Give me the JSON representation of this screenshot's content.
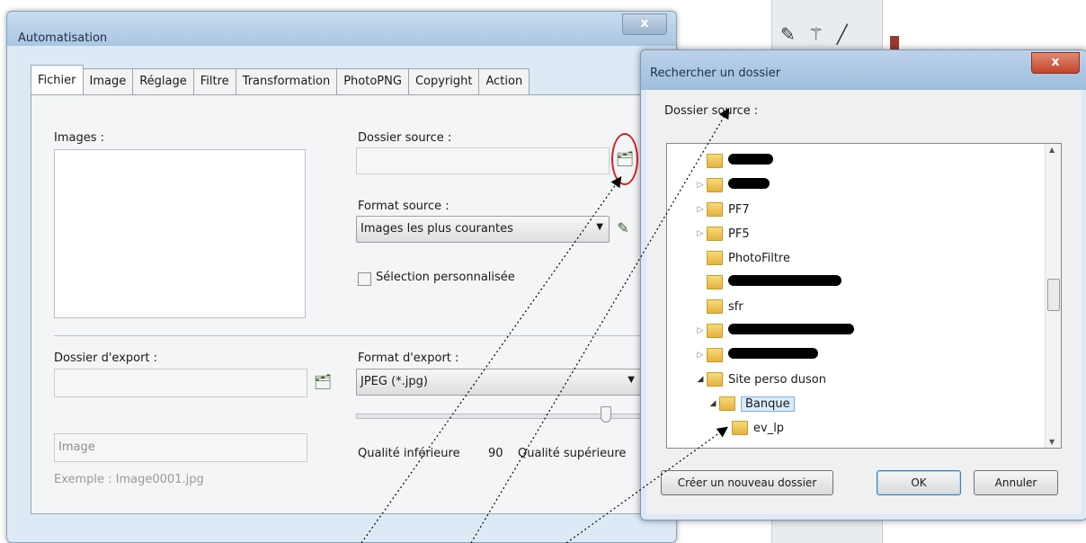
{
  "automatisation": {
    "title": "Automatisation",
    "close": "x",
    "tabs": [
      {
        "label": "Fichier",
        "active": true
      },
      {
        "label": "Image"
      },
      {
        "label": "Réglage"
      },
      {
        "label": "Filtre"
      },
      {
        "label": "Transformation"
      },
      {
        "label": "PhotoPNG"
      },
      {
        "label": "Copyright"
      },
      {
        "label": "Action"
      }
    ],
    "images_label": "Images :",
    "dossier_source_label": "Dossier source :",
    "format_source_label": "Format source :",
    "format_source_value": "Images les plus courantes",
    "selection_label": "Sélection personnalisée",
    "dossier_export_label": "Dossier d'export :",
    "format_export_label": "Format d'export :",
    "format_export_value": "JPEG (*.jpg)",
    "image_name_value": "Image",
    "example_text": "Exemple : Image0001.jpg",
    "quality_low": "Qualité inférieure",
    "quality_value": "90",
    "quality_high": "Qualité supérieure"
  },
  "folder_browser": {
    "title": "Rechercher un dossier",
    "close": "x",
    "label": "Dossier source :",
    "items": [
      {
        "name": "",
        "redacted": true,
        "indent": 1
      },
      {
        "name": "",
        "redacted": true,
        "indent": 1,
        "expand": "collapsed"
      },
      {
        "name": "PF7",
        "indent": 1,
        "expand": "collapsed"
      },
      {
        "name": "PF5",
        "indent": 1,
        "expand": "collapsed"
      },
      {
        "name": "PhotoFiltre",
        "indent": 1
      },
      {
        "name": "",
        "redacted": true,
        "indent": 1
      },
      {
        "name": "sfr",
        "indent": 1
      },
      {
        "name": "",
        "redacted": true,
        "indent": 1,
        "expand": "collapsed"
      },
      {
        "name": "",
        "redacted": true,
        "indent": 1,
        "expand": "collapsed"
      },
      {
        "name": "Site perso duson",
        "indent": 1,
        "expand": "expanded"
      },
      {
        "name": "Banque",
        "indent": 2,
        "expand": "expanded",
        "selected": true
      },
      {
        "name": "ev_lp",
        "indent": 3
      }
    ],
    "new_folder_button": "Créer un nouveau dossier",
    "ok_button": "OK",
    "cancel_button": "Annuler"
  }
}
